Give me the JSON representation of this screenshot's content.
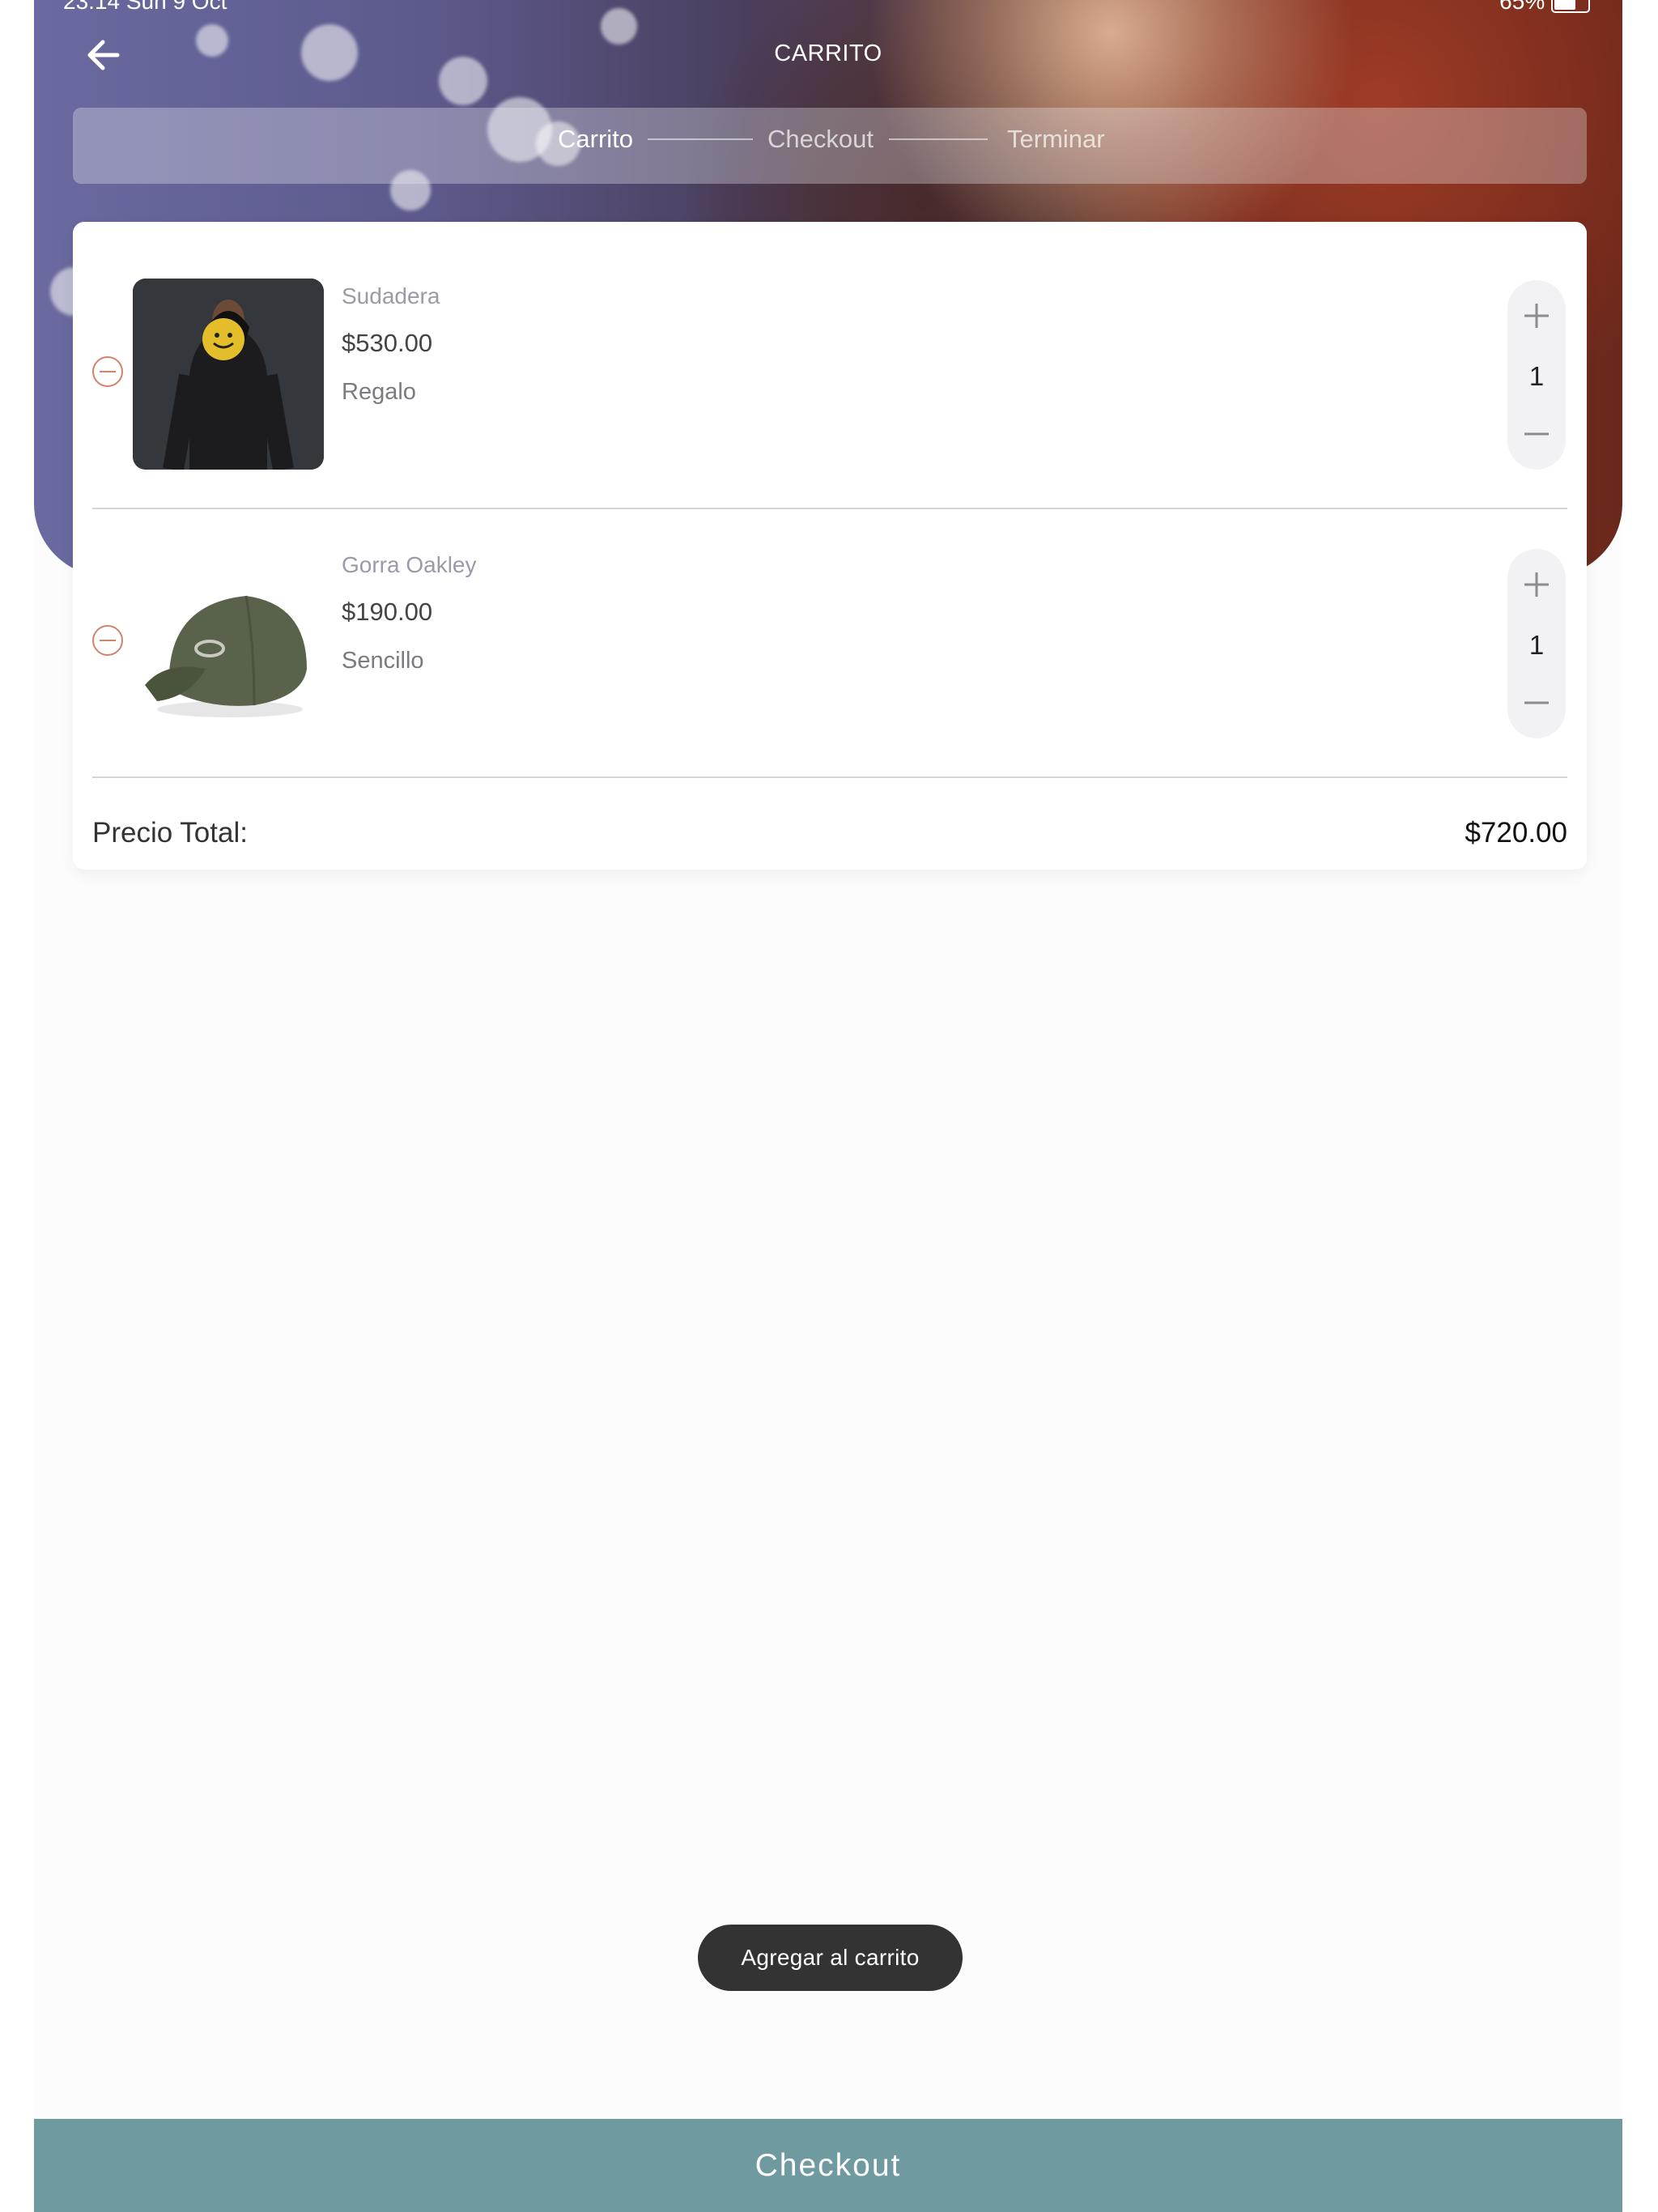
{
  "status_bar": {
    "time": "23:14  Sun 9 Oct",
    "battery": "65%"
  },
  "header": {
    "title": "CARRITO"
  },
  "stepper": {
    "steps": [
      "Carrito",
      "Checkout",
      "Terminar"
    ],
    "active_index": 0
  },
  "cart": {
    "items": [
      {
        "name": "Sudadera",
        "price": "$530.00",
        "variant": "Regalo",
        "quantity": "1",
        "image_icon": "hoodie-image"
      },
      {
        "name": "Gorra Oakley",
        "price": "$190.00",
        "variant": "Sencillo",
        "quantity": "1",
        "image_icon": "cap-image"
      }
    ],
    "total_label": "Precio Total:",
    "total_value": "$720.00"
  },
  "actions": {
    "add_to_cart": "Agregar al carrito",
    "checkout": "Checkout"
  },
  "colors": {
    "checkout_bg": "#6f9a9f",
    "remove_accent": "#d0846e",
    "add_to_cart_bg": "#333333"
  }
}
